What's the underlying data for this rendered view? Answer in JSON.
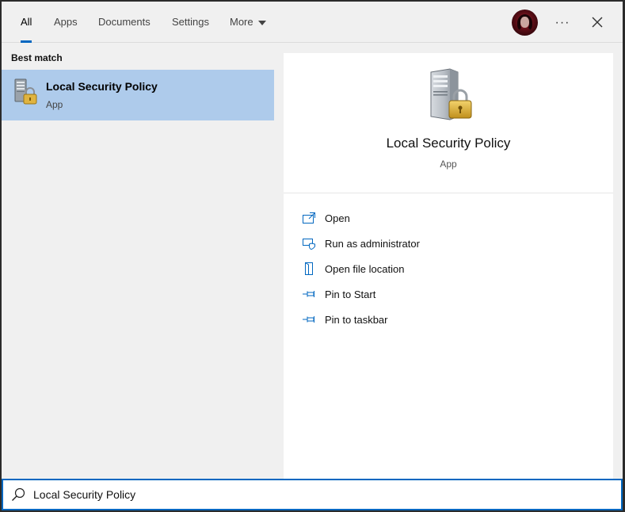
{
  "tabs": [
    {
      "label": "All",
      "active": true
    },
    {
      "label": "Apps",
      "active": false
    },
    {
      "label": "Documents",
      "active": false
    },
    {
      "label": "Settings",
      "active": false
    },
    {
      "label": "More",
      "active": false
    }
  ],
  "header": {
    "avatar_icon": "user-avatar",
    "more_options_icon": "ellipsis-icon",
    "more_options_label": "···",
    "close_icon": "close-icon"
  },
  "results": {
    "section_label": "Best match",
    "best_match": {
      "title": "Local Security Policy",
      "subtitle": "App",
      "icon": "server-lock-icon"
    }
  },
  "details": {
    "title": "Local Security Policy",
    "subtitle": "App",
    "icon": "server-lock-icon",
    "actions": [
      {
        "label": "Open",
        "icon": "open-icon"
      },
      {
        "label": "Run as administrator",
        "icon": "run-as-admin-icon"
      },
      {
        "label": "Open file location",
        "icon": "file-location-icon"
      },
      {
        "label": "Pin to Start",
        "icon": "pin-icon"
      },
      {
        "label": "Pin to taskbar",
        "icon": "pin-icon"
      }
    ]
  },
  "search": {
    "value": "Local Security Policy",
    "icon": "search-icon"
  },
  "colors": {
    "accent": "#0067c0",
    "selection": "#aecbeb",
    "panel_bg": "#f0f0f0",
    "detail_bg": "#ffffff"
  }
}
